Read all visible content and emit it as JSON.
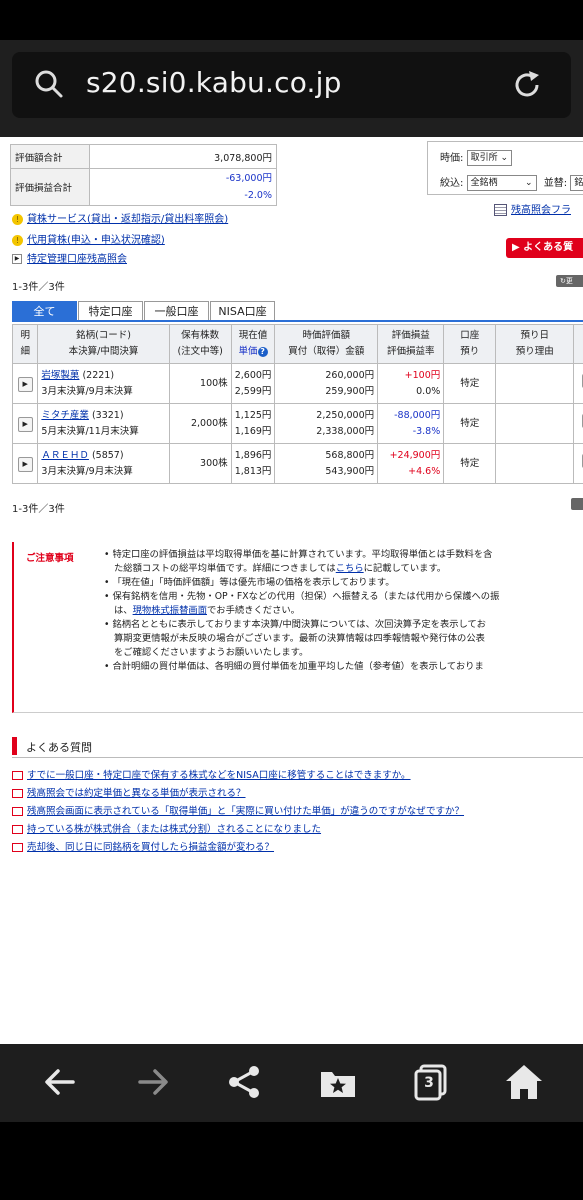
{
  "browser": {
    "url": "s20.si0.kabu.co.jp",
    "tab_count": "3"
  },
  "summary": {
    "valuation_label": "評価額合計",
    "valuation_value": "3,078,800円",
    "pl_label": "評価損益合計",
    "pl_value": "-63,000円",
    "pl_rate": "-2.0%"
  },
  "filters": {
    "price_label": "時価:",
    "price_value": "取引所",
    "filter_label": "絞込:",
    "filter_value": "全銘柄",
    "sort_label": "並替:",
    "sort_value": "銘",
    "balance_link": "残高照会フラ"
  },
  "links": {
    "lending": "貸株サービス(貸出・返却指示/貸出料率照会)",
    "substitute": "代用貸株(申込・申込状況確認)",
    "special_account": "特定管理口座残高照会",
    "faq_button": "▶ よくある質"
  },
  "count_top": "1-3件／3件",
  "count_bottom": "1-3件／3件",
  "update_label": "更",
  "tabs": [
    "全て",
    "特定口座",
    "一般口座",
    "NISA口座"
  ],
  "table": {
    "headers": {
      "detail": [
        "明",
        "細"
      ],
      "name": [
        "銘柄(コード)",
        "本決算/中間決算"
      ],
      "qty": [
        "保有株数",
        "(注文中等)"
      ],
      "price": [
        "現在値",
        "単価"
      ],
      "value": [
        "時価評価額",
        "買付（取得）金額"
      ],
      "pl": [
        "評価損益",
        "評価損益率"
      ],
      "account": [
        "口座",
        "預り"
      ],
      "deposit": [
        "預り日",
        "預り理由"
      ]
    },
    "rows": [
      {
        "name": "岩塚製菓",
        "code": "(2221)",
        "fiscal": "3月末決算/9月末決算",
        "qty": "100株",
        "price": "2,600円",
        "unit": "2,599円",
        "value": "260,000円",
        "cost": "259,900円",
        "pl": "+100円",
        "rate": "0.0%",
        "account": "特定"
      },
      {
        "name": "ミタチ産業",
        "code": "(3321)",
        "fiscal": "5月末決算/11月末決算",
        "qty": "2,000株",
        "price": "1,125円",
        "unit": "1,169円",
        "value": "2,250,000円",
        "cost": "2,338,000円",
        "pl": "-88,000円",
        "rate": "-3.8%",
        "account": "特定"
      },
      {
        "name": "ＡＲＥＨＤ",
        "code": "(5857)",
        "fiscal": "3月末決算/9月末決算",
        "qty": "300株",
        "price": "1,896円",
        "unit": "1,813円",
        "value": "568,800円",
        "cost": "543,900円",
        "pl": "+24,900円",
        "rate": "+4.6%",
        "account": "特定"
      }
    ]
  },
  "notes": {
    "title": "ご注意事項",
    "lines": [
      "• 特定口座の評価損益は平均取得単価を基に計算されています。平均取得単価とは手数料を含",
      "た総額コストの総平均単価です。詳細につきましては",
      "こちら",
      "に記載しています。",
      "• 「現在値」「時価評価額」等は優先市場の価格を表示しております。",
      "• 保有銘柄を信用・先物・OP・FXなどの代用（担保）へ振替える（または代用から保護への振",
      "は、",
      "現物株式振替画面",
      "でお手続きください。",
      "• 銘柄名とともに表示しております本決算/中間決算については、次回決算予定を表示してお",
      "算期変更情報が未反映の場合がございます。最新の決算情報は四季報情報や発行体の公表",
      "をご確認くださいますようお願いいたします。",
      "• 合計明細の買付単価は、各明細の買付単価を加重平均した値（参考値）を表示しておりま"
    ]
  },
  "faq": {
    "title": "よくある質問",
    "items": [
      "すでに一般口座・特定口座で保有する株式などをNISA口座に移管することはできますか。",
      "残高照会では約定単価と異なる単価が表示される？",
      "残高照会画面に表示されている「取得単価」と「実際に買い付けた単価」が違うのですがなぜですか？",
      "持っている株が株式併合（または株式分割）されることになりました",
      "売却後、同じ日に同銘柄を買付したら損益金額が変わる？"
    ]
  },
  "colors": {
    "accent_red": "#e0001b",
    "tab_blue": "#2b6fd6",
    "link_blue": "#0030aa"
  }
}
